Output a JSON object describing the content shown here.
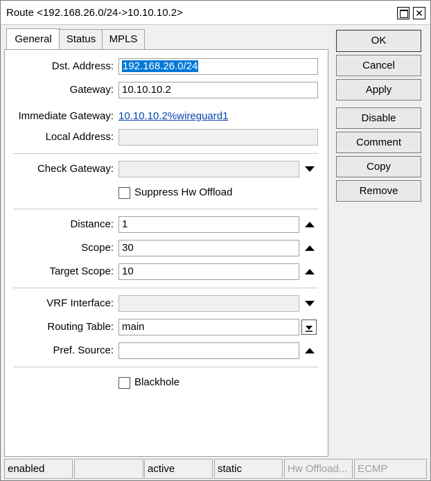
{
  "window": {
    "title": "Route <192.168.26.0/24->10.10.10.2>"
  },
  "tabs": [
    {
      "label": "General",
      "active": true
    },
    {
      "label": "Status",
      "active": false
    },
    {
      "label": "MPLS",
      "active": false
    }
  ],
  "form": {
    "dst_address": {
      "label": "Dst. Address:",
      "value": "192.168.26.0/24"
    },
    "gateway": {
      "label": "Gateway:",
      "value": "10.10.10.2"
    },
    "immediate_gateway": {
      "label": "Immediate Gateway:",
      "value": "10.10.10.2%wireguard1"
    },
    "local_address": {
      "label": "Local Address:",
      "value": ""
    },
    "check_gateway": {
      "label": "Check Gateway:",
      "value": ""
    },
    "suppress_hw_offload": {
      "label": "Suppress Hw Offload",
      "checked": false
    },
    "distance": {
      "label": "Distance:",
      "value": "1"
    },
    "scope": {
      "label": "Scope:",
      "value": "30"
    },
    "target_scope": {
      "label": "Target Scope:",
      "value": "10"
    },
    "vrf_interface": {
      "label": "VRF Interface:",
      "value": ""
    },
    "routing_table": {
      "label": "Routing Table:",
      "value": "main"
    },
    "pref_source": {
      "label": "Pref. Source:",
      "value": ""
    },
    "blackhole": {
      "label": "Blackhole",
      "checked": false
    }
  },
  "buttons": {
    "ok": "OK",
    "cancel": "Cancel",
    "apply": "Apply",
    "disable": "Disable",
    "comment": "Comment",
    "copy": "Copy",
    "remove": "Remove"
  },
  "statusbar": {
    "enabled": "enabled",
    "empty": "",
    "active": "active",
    "static": "static",
    "hw_offload": "Hw Offload...",
    "ecmp": "ECMP"
  },
  "colors": {
    "selection": "#0078d7",
    "link": "#0645ad",
    "disabled_text": "#a0a0a0"
  },
  "icons": [
    "maximize-icon",
    "close-icon",
    "dropdown-arrow-icon",
    "up-arrow-icon",
    "dropdown-toggle-icon"
  ]
}
